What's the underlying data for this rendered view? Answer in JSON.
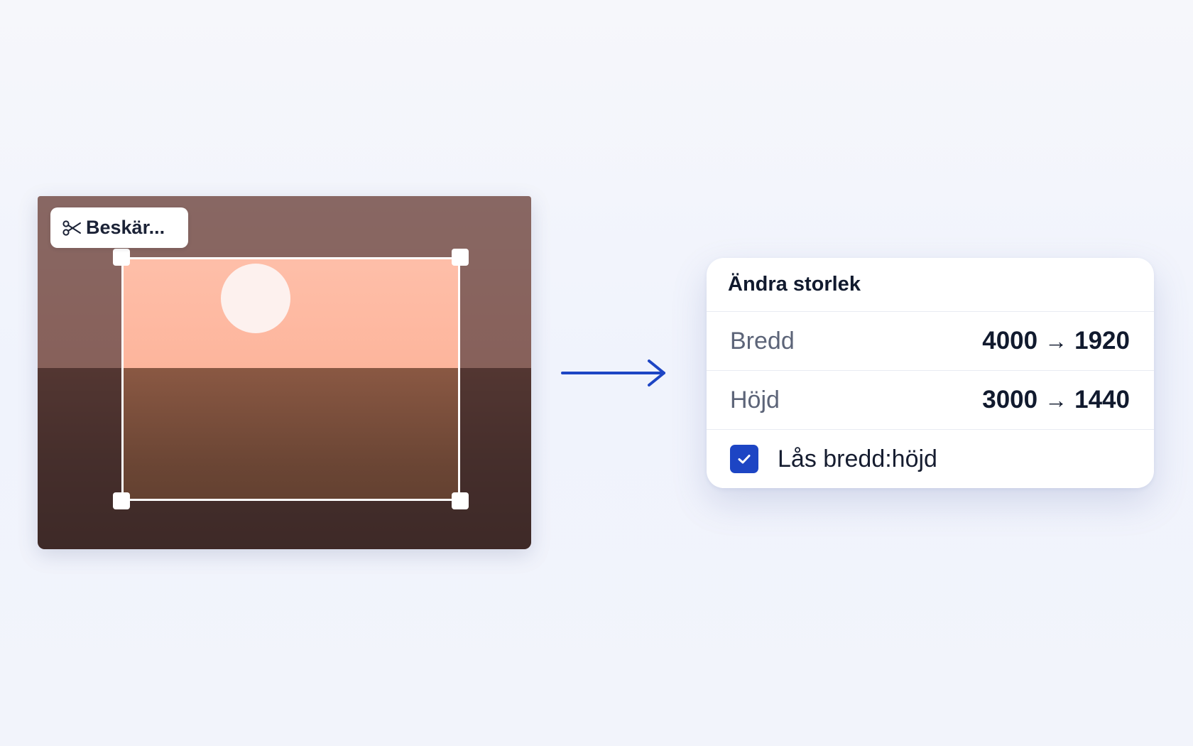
{
  "crop_tool": {
    "button_label": "Beskär...",
    "button_icon": "scissors-icon"
  },
  "resize_panel": {
    "title": "Ändra storlek",
    "rows": [
      {
        "label": "Bredd",
        "from": "4000",
        "to": "1920"
      },
      {
        "label": "Höjd",
        "from": "3000",
        "to": "1440"
      }
    ],
    "lock_aspect": {
      "label": "Lås bredd:höjd",
      "checked": true
    }
  },
  "colors": {
    "accent": "#1d45c4",
    "sky": "#fdb59c",
    "ground": "#6a4534",
    "sun": "#fdf1ee"
  }
}
